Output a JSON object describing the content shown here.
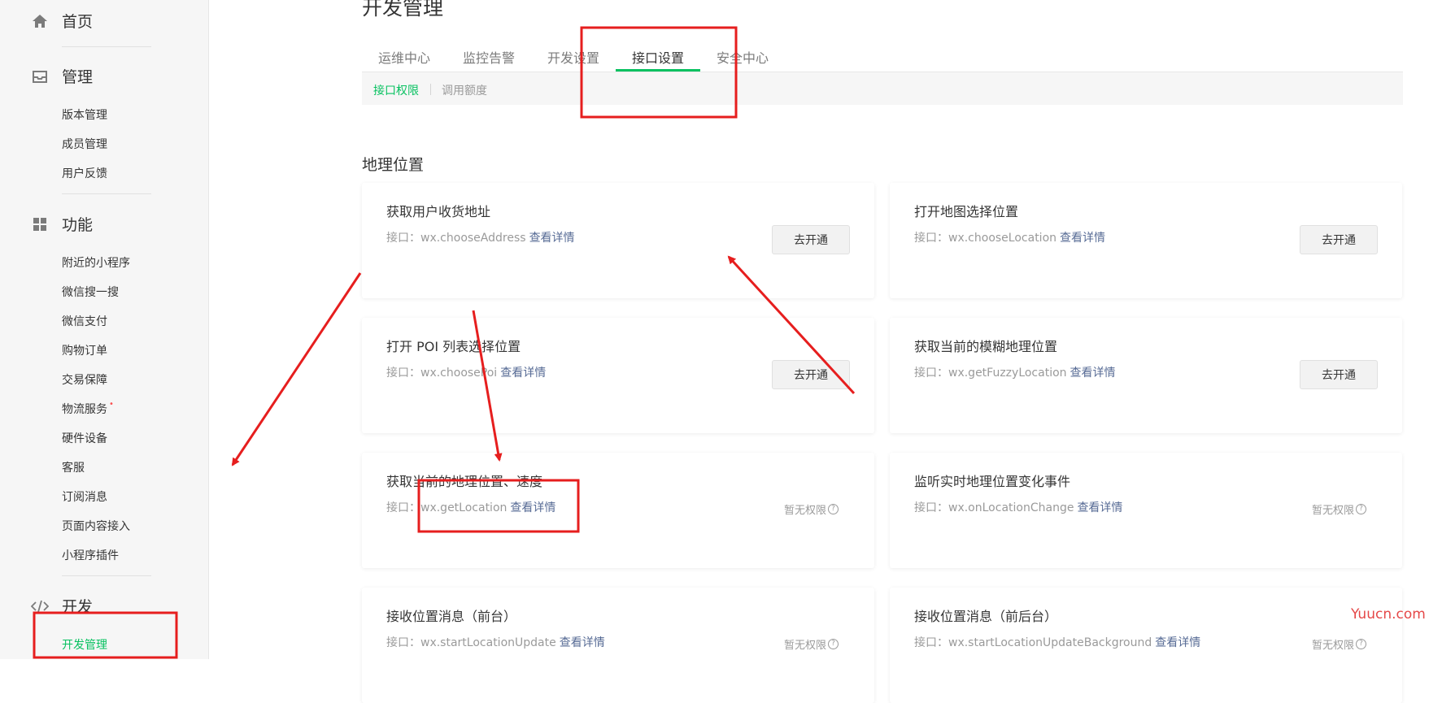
{
  "sidebar": {
    "groups": [
      {
        "label": "首页",
        "icon": "home-icon"
      },
      {
        "label": "管理",
        "icon": "inbox-icon"
      },
      {
        "label": "功能",
        "icon": "grid-icon"
      },
      {
        "label": "开发",
        "icon": "code-icon"
      }
    ],
    "manage_items": [
      "版本管理",
      "成员管理",
      "用户反馈"
    ],
    "feature_items": [
      "附近的小程序",
      "微信搜一搜",
      "微信支付",
      "购物订单",
      "交易保障",
      "物流服务",
      "硬件设备",
      "客服",
      "订阅消息",
      "页面内容接入",
      "小程序插件"
    ],
    "logistics_dot": "•",
    "dev_items": [
      "开发管理"
    ]
  },
  "page_title": "开发管理",
  "tabs": [
    "运维中心",
    "监控告警",
    "开发设置",
    "接口设置",
    "安全中心"
  ],
  "active_tab": "接口设置",
  "subtabs": [
    "接口权限",
    "调用额度"
  ],
  "section_title": "地理位置",
  "api_prefix": "接口：",
  "detail_link": "查看详情",
  "enable_label": "去开通",
  "no_permission_label": "暂无权限",
  "cards": [
    {
      "title": "获取用户收货地址",
      "api": "wx.chooseAddress",
      "action": "button"
    },
    {
      "title": "打开地图选择位置",
      "api": "wx.chooseLocation",
      "action": "button"
    },
    {
      "title": "打开 POI 列表选择位置",
      "api": "wx.choosePoi",
      "action": "button"
    },
    {
      "title": "获取当前的模糊地理位置",
      "api": "wx.getFuzzyLocation",
      "action": "button"
    },
    {
      "title": "获取当前的地理位置、速度",
      "api": "wx.getLocation",
      "action": "none"
    },
    {
      "title": "监听实时地理位置变化事件",
      "api": "wx.onLocationChange",
      "action": "none"
    },
    {
      "title": "接收位置消息（前台）",
      "api": "wx.startLocationUpdate",
      "action": "none"
    },
    {
      "title": "接收位置消息（前后台）",
      "api": "wx.startLocationUpdateBackground",
      "action": "none"
    }
  ],
  "watermark": "Yuucn.com",
  "colors": {
    "accent": "#07c160",
    "link": "#576b95",
    "annotation": "#e61e1e"
  }
}
